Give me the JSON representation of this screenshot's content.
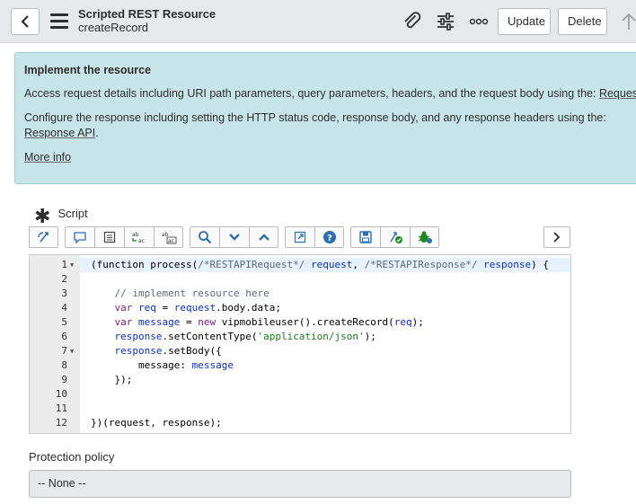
{
  "header": {
    "title": "Scripted REST Resource",
    "subtitle": "createRecord",
    "update_label": "Update",
    "delete_label": "Delete",
    "icons": [
      "back-arrow-icon",
      "hamburger-menu-icon",
      "paperclip-icon",
      "settings-sliders-icon",
      "more-options-icon",
      "scroll-up-arrow-icon"
    ]
  },
  "info": {
    "title": "Implement the resource",
    "line1_text": "Access request details including URI path parameters, query parameters, headers, and the request body using the: ",
    "line1_link": "Request API",
    "line2_text": "Configure the response including setting the HTTP status code, response body, and any response headers using the: ",
    "line2_link": "Response API",
    "line2_end": ".",
    "more_info": "More info"
  },
  "script_field": {
    "label": "Script",
    "toolbar_icons": [
      "format-code-icon",
      "comment-icon",
      "document-icon",
      "replace-icon",
      "replace-all-icon",
      "search-icon",
      "chevron-down-icon",
      "chevron-up-icon",
      "fullscreen-icon",
      "help-icon",
      "save-icon",
      "script-check-icon",
      "debug-icon",
      "chevron-right-icon"
    ]
  },
  "code": {
    "lines": [
      {
        "n": "1",
        "fold": true,
        "tokens": [
          [
            "p",
            "(function process("
          ],
          [
            "cm",
            "/*RESTAPIRequest*/"
          ],
          [
            "p",
            " "
          ],
          [
            "vr",
            "request"
          ],
          [
            "p",
            ", "
          ],
          [
            "cm",
            "/*RESTAPIResponse*/"
          ],
          [
            "p",
            " "
          ],
          [
            "vr",
            "response"
          ],
          [
            "p",
            ") {"
          ]
        ]
      },
      {
        "n": "2",
        "fold": false,
        "tokens": []
      },
      {
        "n": "3",
        "fold": false,
        "tokens": [
          [
            "p",
            "    "
          ],
          [
            "cm",
            "// implement resource here"
          ]
        ]
      },
      {
        "n": "4",
        "fold": false,
        "tokens": [
          [
            "p",
            "    "
          ],
          [
            "kw",
            "var"
          ],
          [
            "p",
            " "
          ],
          [
            "vr",
            "req"
          ],
          [
            "p",
            " = "
          ],
          [
            "vr",
            "request"
          ],
          [
            "p",
            ".body.data;"
          ]
        ]
      },
      {
        "n": "5",
        "fold": false,
        "tokens": [
          [
            "p",
            "    "
          ],
          [
            "kw",
            "var"
          ],
          [
            "p",
            " "
          ],
          [
            "vr",
            "message"
          ],
          [
            "p",
            " = "
          ],
          [
            "kw",
            "new"
          ],
          [
            "p",
            " vipmobileuser().createRecord("
          ],
          [
            "vr",
            "req"
          ],
          [
            "p",
            ");"
          ]
        ]
      },
      {
        "n": "6",
        "fold": false,
        "tokens": [
          [
            "p",
            "    "
          ],
          [
            "vr",
            "response"
          ],
          [
            "p",
            ".setContentType("
          ],
          [
            "st",
            "'application/json'"
          ],
          [
            "p",
            ");"
          ]
        ]
      },
      {
        "n": "7",
        "fold": true,
        "tokens": [
          [
            "p",
            "    "
          ],
          [
            "vr",
            "response"
          ],
          [
            "p",
            ".setBody({"
          ]
        ]
      },
      {
        "n": "8",
        "fold": false,
        "tokens": [
          [
            "p",
            "        message: "
          ],
          [
            "vr",
            "message"
          ]
        ]
      },
      {
        "n": "9",
        "fold": false,
        "tokens": [
          [
            "p",
            "    });"
          ]
        ]
      },
      {
        "n": "10",
        "fold": false,
        "tokens": []
      },
      {
        "n": "11",
        "fold": false,
        "tokens": []
      },
      {
        "n": "12",
        "fold": false,
        "tokens": [
          [
            "p",
            "})(request, response);"
          ]
        ]
      }
    ]
  },
  "protection_policy": {
    "label": "Protection policy",
    "value": "-- None --"
  }
}
